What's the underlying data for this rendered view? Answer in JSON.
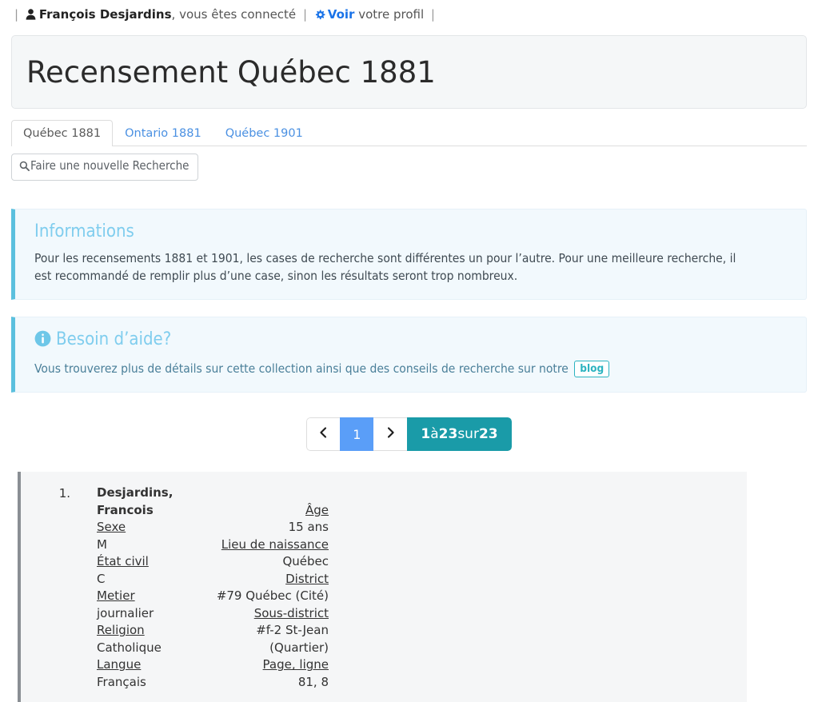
{
  "userbar": {
    "leading_sep": "|",
    "user_icon": "user-icon",
    "user_name": "François Desjardins",
    "status_text": ", vous êtes connecté",
    "mid_sep": "|",
    "gear_icon": "gear-icon",
    "profile_link": "Voir",
    "profile_rest": " votre profil",
    "trailing_sep": "|"
  },
  "header": {
    "title": "Recensement Québec 1881"
  },
  "tabs": [
    {
      "label": "Québec 1881",
      "active": true
    },
    {
      "label": "Ontario 1881",
      "active": false
    },
    {
      "label": "Québec 1901",
      "active": false
    }
  ],
  "toolbar": {
    "search_icon": "magnifier-icon",
    "new_search_label": "Faire une nouvelle Recherche"
  },
  "panels": [
    {
      "name": "informations",
      "icon": null,
      "title": "Informations",
      "body": "Pour les recensements 1881 et 1901, les cases de recherche sont différentes un pour l’autre. Pour une meilleure recherche, il est recommandé de remplir plus d’une case, sinon les résultats seront trop nombreux."
    },
    {
      "name": "besoin-aide",
      "icon": "info-circle-icon",
      "title": "Besoin d’aide?",
      "body": "Vous trouverez plus de détails sur cette collection ainsi que des conseils de recherche sur notre",
      "badge": "blog"
    }
  ],
  "pagination": {
    "prev_icon": "chevron-left-icon",
    "next_icon": "chevron-right-icon",
    "current_page": "1",
    "count_from": "1",
    "count_sep_1": " à ",
    "count_to": "23",
    "count_sep_2": " sur ",
    "count_total": "23"
  },
  "results": [
    {
      "index": "1.",
      "left_column": [
        {
          "text": "Desjardins,",
          "style": "name"
        },
        {
          "text": "Francois",
          "style": "name"
        },
        {
          "text": "Sexe",
          "style": "label"
        },
        {
          "text": "M",
          "style": "value"
        },
        {
          "text": "État civil",
          "style": "label"
        },
        {
          "text": "C",
          "style": "value"
        },
        {
          "text": "Metier",
          "style": "label"
        },
        {
          "text": "journalier",
          "style": "value"
        },
        {
          "text": "Religion",
          "style": "label"
        },
        {
          "text": "Catholique",
          "style": "value"
        },
        {
          "text": "Langue",
          "style": "label"
        },
        {
          "text": "Français",
          "style": "value"
        }
      ],
      "right_column": [
        {
          "text": "",
          "style": "value"
        },
        {
          "text": "Âge",
          "style": "label"
        },
        {
          "text": "15 ans",
          "style": "value"
        },
        {
          "text": "Lieu de naissance",
          "style": "label"
        },
        {
          "text": "Québec",
          "style": "value"
        },
        {
          "text": "District",
          "style": "label"
        },
        {
          "text": "#79 Québec (Cité)",
          "style": "value"
        },
        {
          "text": "Sous-district",
          "style": "label"
        },
        {
          "text": "#f-2 St-Jean",
          "style": "value"
        },
        {
          "text": "(Quartier)",
          "style": "value"
        },
        {
          "text": "Page, ligne",
          "style": "label"
        },
        {
          "text": "81, 8",
          "style": "value"
        }
      ]
    }
  ],
  "colors": {
    "link_blue": "#1a73e8",
    "tab_blue": "#4a90e2",
    "panel_accent": "#5bc0de",
    "panel_title": "#7fcdee",
    "pager_active": "#5a9ef8",
    "pager_count": "#1a9ba8",
    "badge_teal": "#2bb3c0",
    "record_accent": "#8a8f94"
  }
}
